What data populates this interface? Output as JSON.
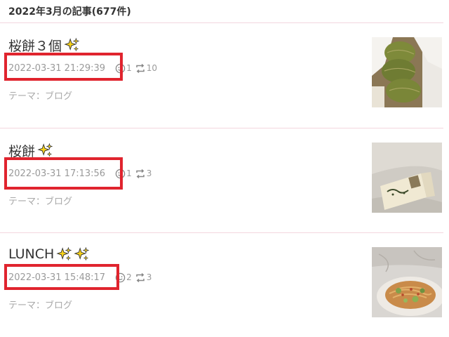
{
  "header": {
    "title": "2022年3月の記事(677件)"
  },
  "entries": [
    {
      "title": "桜餅３個",
      "timestamp": "2022-03-31 21:29:39",
      "likes": "1",
      "reblogs": "10",
      "theme_label": "テーマ：",
      "theme": "ブログ",
      "sparkles": 1,
      "thumbnail": "sakura-mochi-in-paper-photo"
    },
    {
      "title": "桜餅",
      "timestamp": "2022-03-31 17:13:56",
      "likes": "1",
      "reblogs": "3",
      "theme_label": "テーマ：",
      "theme": "ブログ",
      "sparkles": 1,
      "thumbnail": "sakura-mochi-box-photo"
    },
    {
      "title": "LUNCH",
      "timestamp": "2022-03-31 15:48:17",
      "likes": "2",
      "reblogs": "3",
      "theme_label": "テーマ：",
      "theme": "ブログ",
      "sparkles": 2,
      "thumbnail": "pasta-plate-photo"
    }
  ],
  "colors": {
    "highlight": "#e0242e",
    "divider": "#f3d6df",
    "meta_text": "#9a9a9a",
    "sparkle": "#f7d21a"
  }
}
